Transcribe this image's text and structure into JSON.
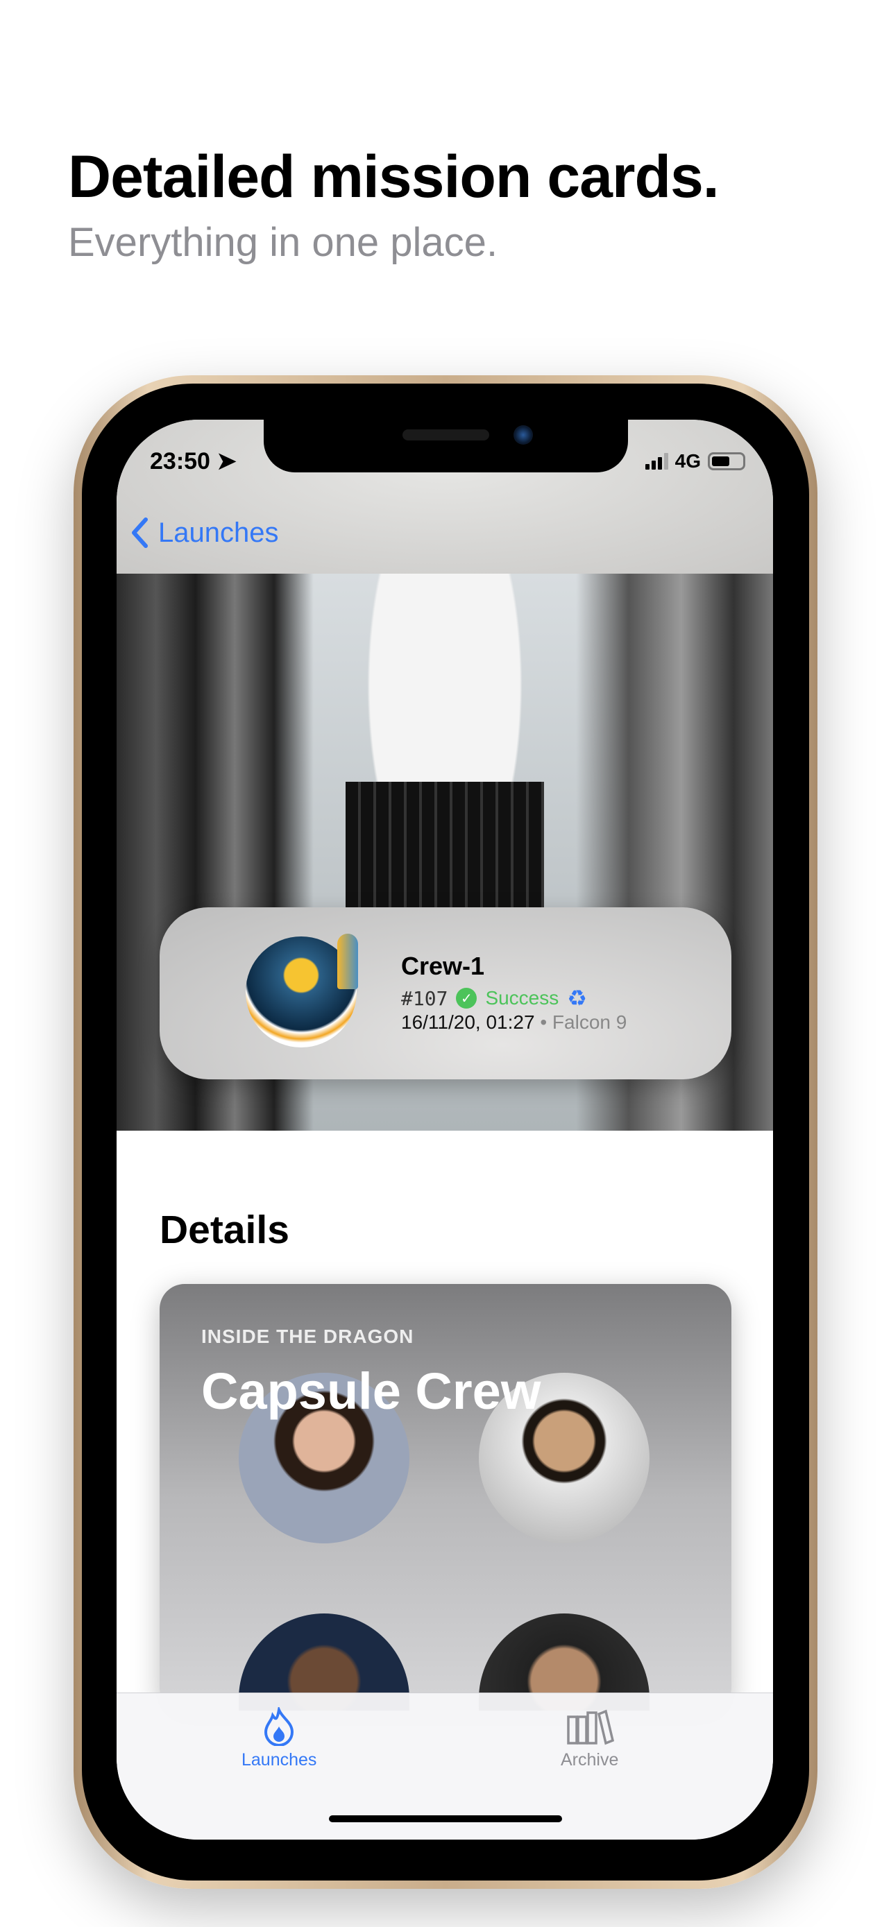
{
  "promo": {
    "title": "Detailed mission cards.",
    "subtitle": "Everything in one place."
  },
  "status_bar": {
    "time": "23:50",
    "network": "4G",
    "battery_percent": 60
  },
  "nav": {
    "back_label": "Launches"
  },
  "launch": {
    "name": "Crew-1",
    "number": "#107",
    "status": "Success",
    "date": "16/11/20, 01:27",
    "separator": "•",
    "rocket": "Falcon 9",
    "status_color": "#4cc35a",
    "accent": "#3478f6"
  },
  "details": {
    "heading": "Details",
    "card": {
      "eyebrow": "INSIDE THE DRAGON",
      "title": "Capsule Crew"
    }
  },
  "tabs": [
    {
      "label": "Launches",
      "icon": "flame-icon",
      "active": true
    },
    {
      "label": "Archive",
      "icon": "books-icon",
      "active": false
    }
  ]
}
